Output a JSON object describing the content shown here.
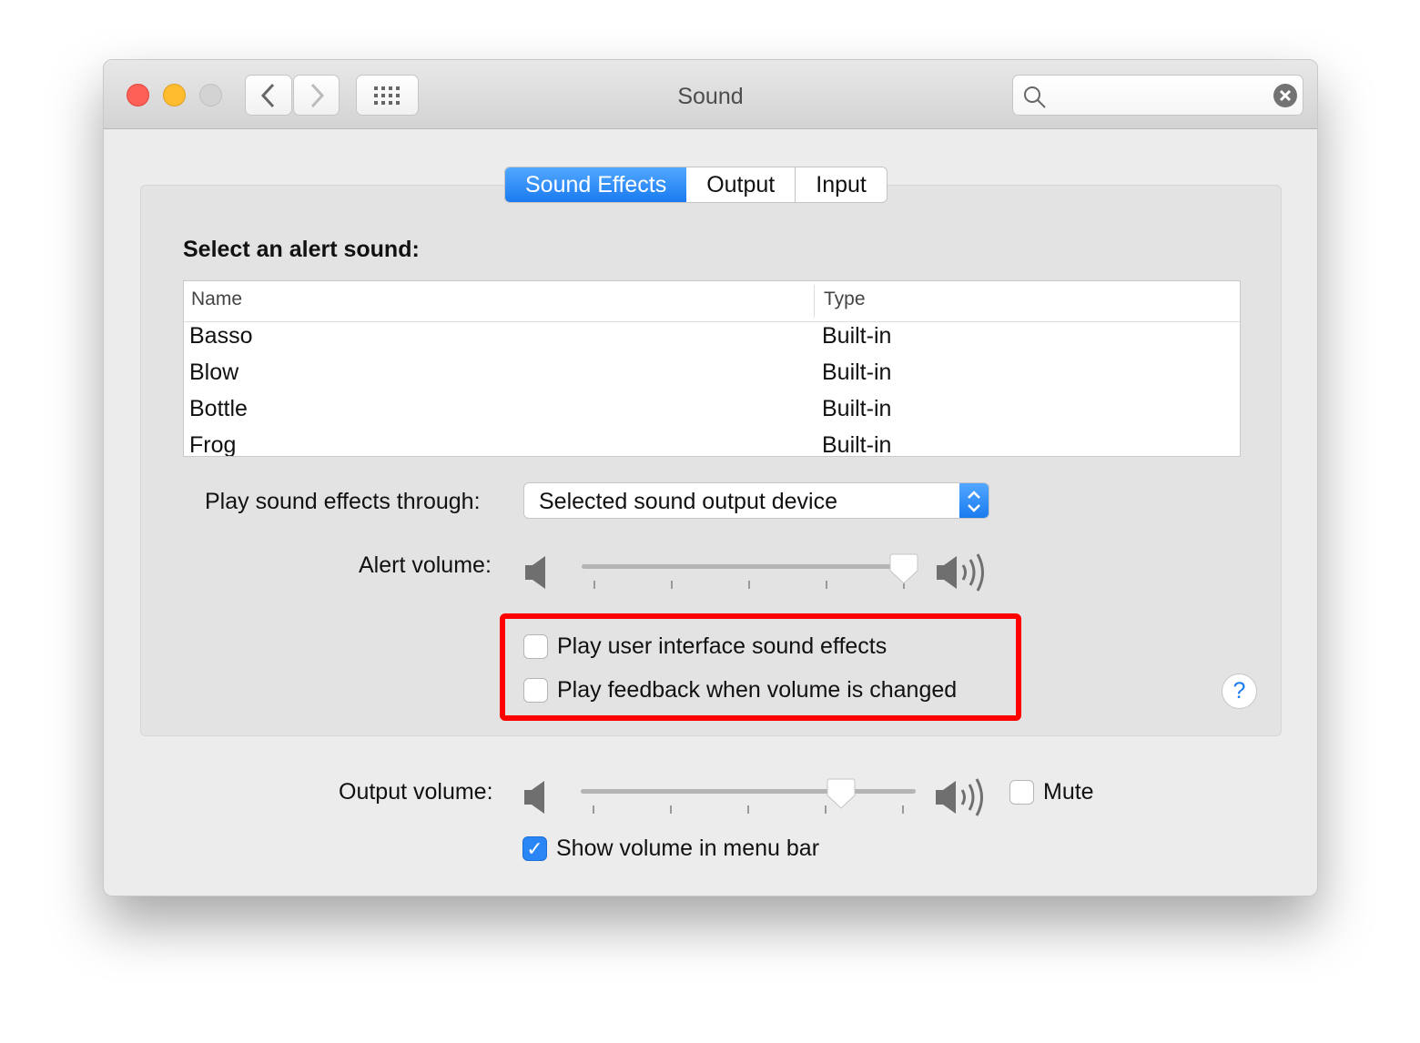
{
  "window": {
    "title": "Sound"
  },
  "toolbar": {
    "back": "back-icon",
    "forward": "forward-icon",
    "grid": "grid-icon",
    "search_value": "",
    "search_placeholder": ""
  },
  "tabs": [
    {
      "label": "Sound Effects",
      "selected": true
    },
    {
      "label": "Output",
      "selected": false
    },
    {
      "label": "Input",
      "selected": false
    }
  ],
  "alert": {
    "heading": "Select an alert sound:",
    "columns": [
      "Name",
      "Type"
    ],
    "rows": [
      [
        "Basso",
        "Built-in"
      ],
      [
        "Blow",
        "Built-in"
      ],
      [
        "Bottle",
        "Built-in"
      ],
      [
        "Frog",
        "Built-in"
      ]
    ],
    "play_through_label": "Play sound effects through:",
    "play_through_value": "Selected sound output device",
    "volume_label": "Alert volume:",
    "volume": 1.0
  },
  "checkboxes": {
    "ui_effects": {
      "label": "Play user interface sound effects",
      "checked": false
    },
    "feedback": {
      "label": "Play feedback when volume is changed",
      "checked": false
    }
  },
  "help": "?",
  "output": {
    "volume_label": "Output volume:",
    "volume": 0.8,
    "mute_label": "Mute",
    "mute": false,
    "menu_bar_label": "Show volume in menu bar",
    "menu_bar": true
  },
  "colors": {
    "accent": "#1a7bf0",
    "highlight": "#ff0000",
    "close": "#fe5f57",
    "minimize": "#febc2e"
  }
}
